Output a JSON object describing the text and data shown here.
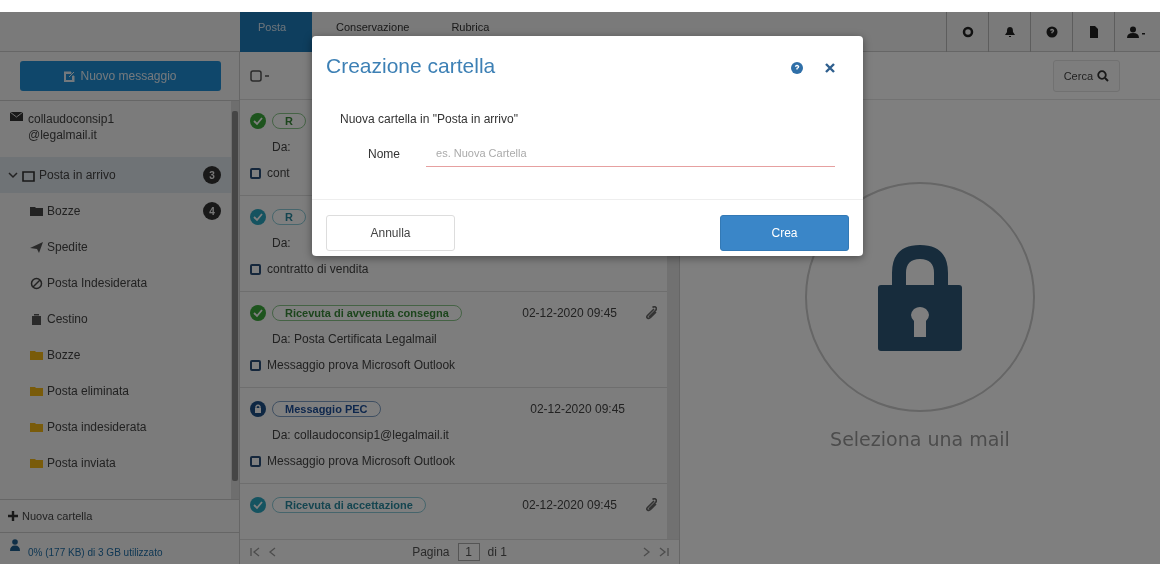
{
  "top_nav": {
    "tabs": [
      {
        "label": "Posta",
        "selected": true
      },
      {
        "label": "Conservazione",
        "selected": false
      },
      {
        "label": "Rubrica",
        "selected": false
      }
    ]
  },
  "sidebar": {
    "new_message_button": "Nuovo messaggio",
    "account": {
      "label": "collaudoconsip1@legalmail.it",
      "children": [
        {
          "label": "Posta in arrivo",
          "kind": "inbox",
          "selected": true,
          "expanded": true,
          "badge": "3"
        },
        {
          "label": "Bozze",
          "kind": "drafts",
          "selected": false,
          "badge": "4"
        },
        {
          "label": "Spedite",
          "kind": "sent",
          "selected": false
        },
        {
          "label": "Posta Indesiderata",
          "kind": "spam",
          "selected": false
        },
        {
          "label": "Cestino",
          "kind": "trash",
          "selected": false
        },
        {
          "label": "Bozze",
          "kind": "folder",
          "selected": false
        },
        {
          "label": "Posta eliminata",
          "kind": "folder",
          "selected": false
        },
        {
          "label": "Posta indesiderata",
          "kind": "folder",
          "selected": false
        },
        {
          "label": "Posta inviata",
          "kind": "folder",
          "selected": false
        }
      ]
    },
    "new_folder": "Nuova cartella",
    "storage": "0% (177 KB) di 3 GB utilizzato"
  },
  "message_list": {
    "messages": [
      {
        "kind": "delivered",
        "badge": "R",
        "from": "Da:",
        "subject": "cont",
        "checked": false
      },
      {
        "kind": "accepted",
        "badge": "R",
        "from": "Da:",
        "subject": "contratto di vendita",
        "checked": false
      },
      {
        "kind": "delivered",
        "badge": "Ricevuta di avvenuta consegna",
        "date": "02-12-2020 09:45",
        "attachment": true,
        "from": "Da: Posta Certificata Legalmail",
        "subject": "Messaggio prova Microsoft Outlook",
        "checked": false
      },
      {
        "kind": "pec",
        "badge": "Messaggio PEC",
        "date": "02-12-2020 09:45",
        "attachment": false,
        "from": "Da: collaudoconsip1@legalmail.it",
        "subject": "Messaggio prova Microsoft Outlook",
        "checked": false
      },
      {
        "kind": "accepted",
        "badge": "Ricevuta di accettazione",
        "date": "02-12-2020 09:45",
        "attachment": true
      }
    ],
    "pager": {
      "label": "Pagina",
      "page": "1",
      "total": "di 1"
    }
  },
  "reader": {
    "search_button": "Cerca",
    "empty_text": "Seleziona una mail"
  },
  "dialog": {
    "title": "Creazione cartella",
    "subtitle": "Nuova cartella in \"Posta in arrivo\"",
    "field_label": "Nome",
    "placeholder": "es. Nuova Cartella",
    "cancel_button": "Annulla",
    "create_button": "Crea"
  }
}
